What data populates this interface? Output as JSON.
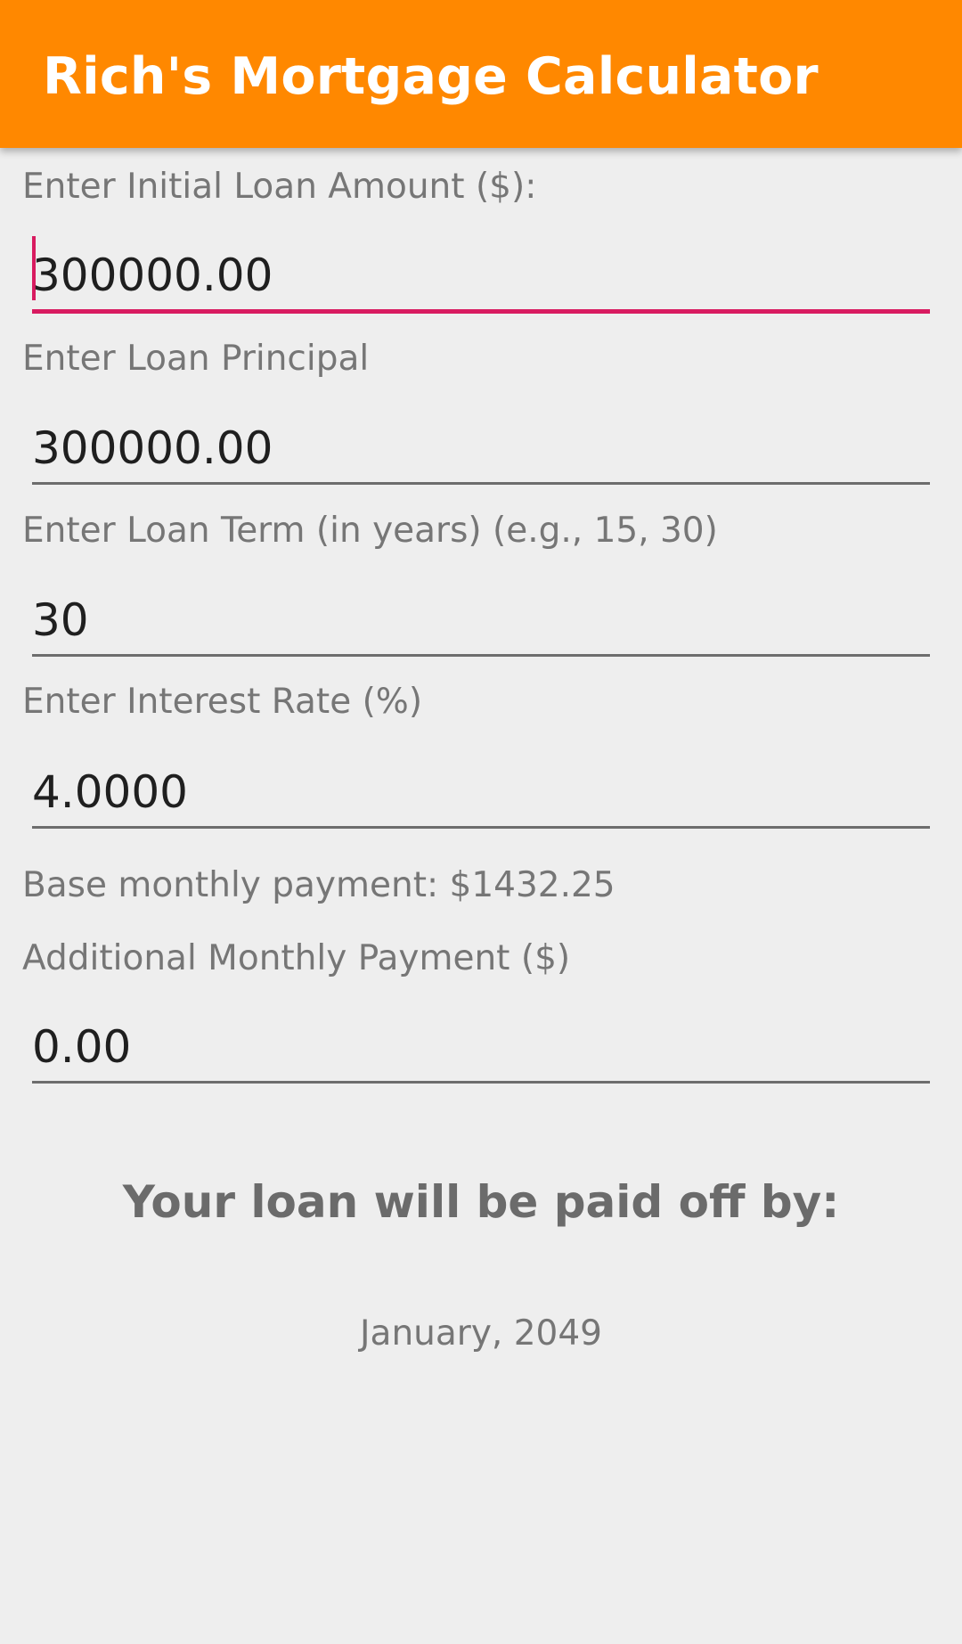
{
  "app_bar": {
    "title": "Rich's Mortgage Calculator",
    "background_color": "#ff8800"
  },
  "form": {
    "initial_loan_amount": {
      "label": "Enter Initial Loan Amount ($):",
      "value": "300000.00",
      "focused": true
    },
    "loan_principal": {
      "label": "Enter Loan Principal",
      "value": "300000.00"
    },
    "loan_term": {
      "label": "Enter Loan Term (in years) (e.g., 15, 30)",
      "value": "30"
    },
    "interest_rate": {
      "label": "Enter Interest Rate (%)",
      "value": "4.0000"
    },
    "base_monthly_payment_text": "Base monthly payment: $1432.25",
    "additional_monthly_payment": {
      "label": "Additional Monthly Payment ($)",
      "value": "0.00"
    }
  },
  "result": {
    "heading": "Your loan will be paid off by:",
    "payoff_date": "January, 2049"
  },
  "colors": {
    "accent": "#d81b60",
    "background": "#eeeeee",
    "label_text": "#767676",
    "value_text": "#1f1f1f"
  }
}
